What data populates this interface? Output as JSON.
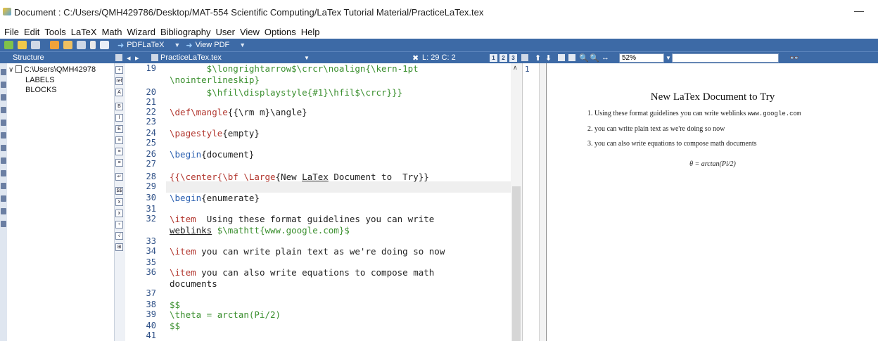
{
  "window": {
    "title": "Document : C:/Users/QMH429786/Desktop/MAT-554 Scientific Computing/LaTex Tutorial Material/PracticeLaTex.tex"
  },
  "menu": [
    "File",
    "Edit",
    "Tools",
    "LaTeX",
    "Math",
    "Wizard",
    "Bibliography",
    "User",
    "View",
    "Options",
    "Help"
  ],
  "toolbar": {
    "compiler": "PDFLaTeX",
    "view_pdf": "View PDF"
  },
  "panels": {
    "structure_title": "Structure",
    "tab_name": "PracticeLaTex.tex",
    "position": "L: 29 C: 2",
    "zoom": "52%",
    "pages": [
      "1",
      "2",
      "3"
    ]
  },
  "structure": {
    "root": "C:\\Users\\QMH42978",
    "children": [
      "LABELS",
      "BLOCKS"
    ]
  },
  "editor": {
    "line_numbers": [
      "19",
      "20",
      "21",
      "22",
      "23",
      "24",
      "25",
      "26",
      "27",
      "28",
      "29",
      "30",
      "31",
      "32",
      "33",
      "34",
      "35",
      "36",
      "37",
      "38",
      "39",
      "40",
      "41"
    ],
    "lines": {
      "l19a": "       $\\longrightarrow$\\crcr\\noalign{\\kern-1pt",
      "l19b": "\\nointerlineskip}",
      "l20": "       $\\hfil\\displaystyle{#1}\\hfil$\\crcr}}}",
      "l22_cmd": "\\def\\mangle",
      "l22_rest": "{{\\rm m}\\angle}",
      "l24_cmd": "\\pagestyle",
      "l24_arg": "{empty}",
      "l26_cmd": "\\begin",
      "l26_arg": "{document}",
      "l28_a": "{{\\center{\\bf \\Large",
      "l28_b": "{New ",
      "l28_c": "LaTex",
      "l28_d": " Document to  Try}}",
      "l30_cmd": "\\begin",
      "l30_arg": "{enumerate}",
      "l32_cmd": "\\item",
      "l32_rest": "  Using these format guidelines you can write",
      "l32b_a": "weblinks",
      "l32b_b": " $\\mathtt{www.google.com}$",
      "l34_cmd": "\\item",
      "l34_rest": " you can write plain text as we're doing so now",
      "l36_cmd": "\\item",
      "l36_rest": " you can also write equations to compose math",
      "l36b": "documents",
      "l38": "$$",
      "l39": "\\theta = arctan(Pi/2)",
      "l40": "$$"
    }
  },
  "log": {
    "line": "1"
  },
  "pdf": {
    "title": "New LaTex Document to Try",
    "items": [
      {
        "num": "1.",
        "text": "Using these format guidelines you can write weblinks",
        "mono": "www.google.com"
      },
      {
        "num": "2.",
        "text": "you can write plain text as we're doing so now",
        "mono": ""
      },
      {
        "num": "3.",
        "text": "you can also write equations to compose math documents",
        "mono": ""
      }
    ],
    "equation": "θ = arctan(Pi/2)"
  },
  "colors": {
    "toolbar_bg": "#3d6aa6",
    "keyword": "#b2362e",
    "math": "#3a8f2e",
    "line_number": "#2d4f86"
  }
}
